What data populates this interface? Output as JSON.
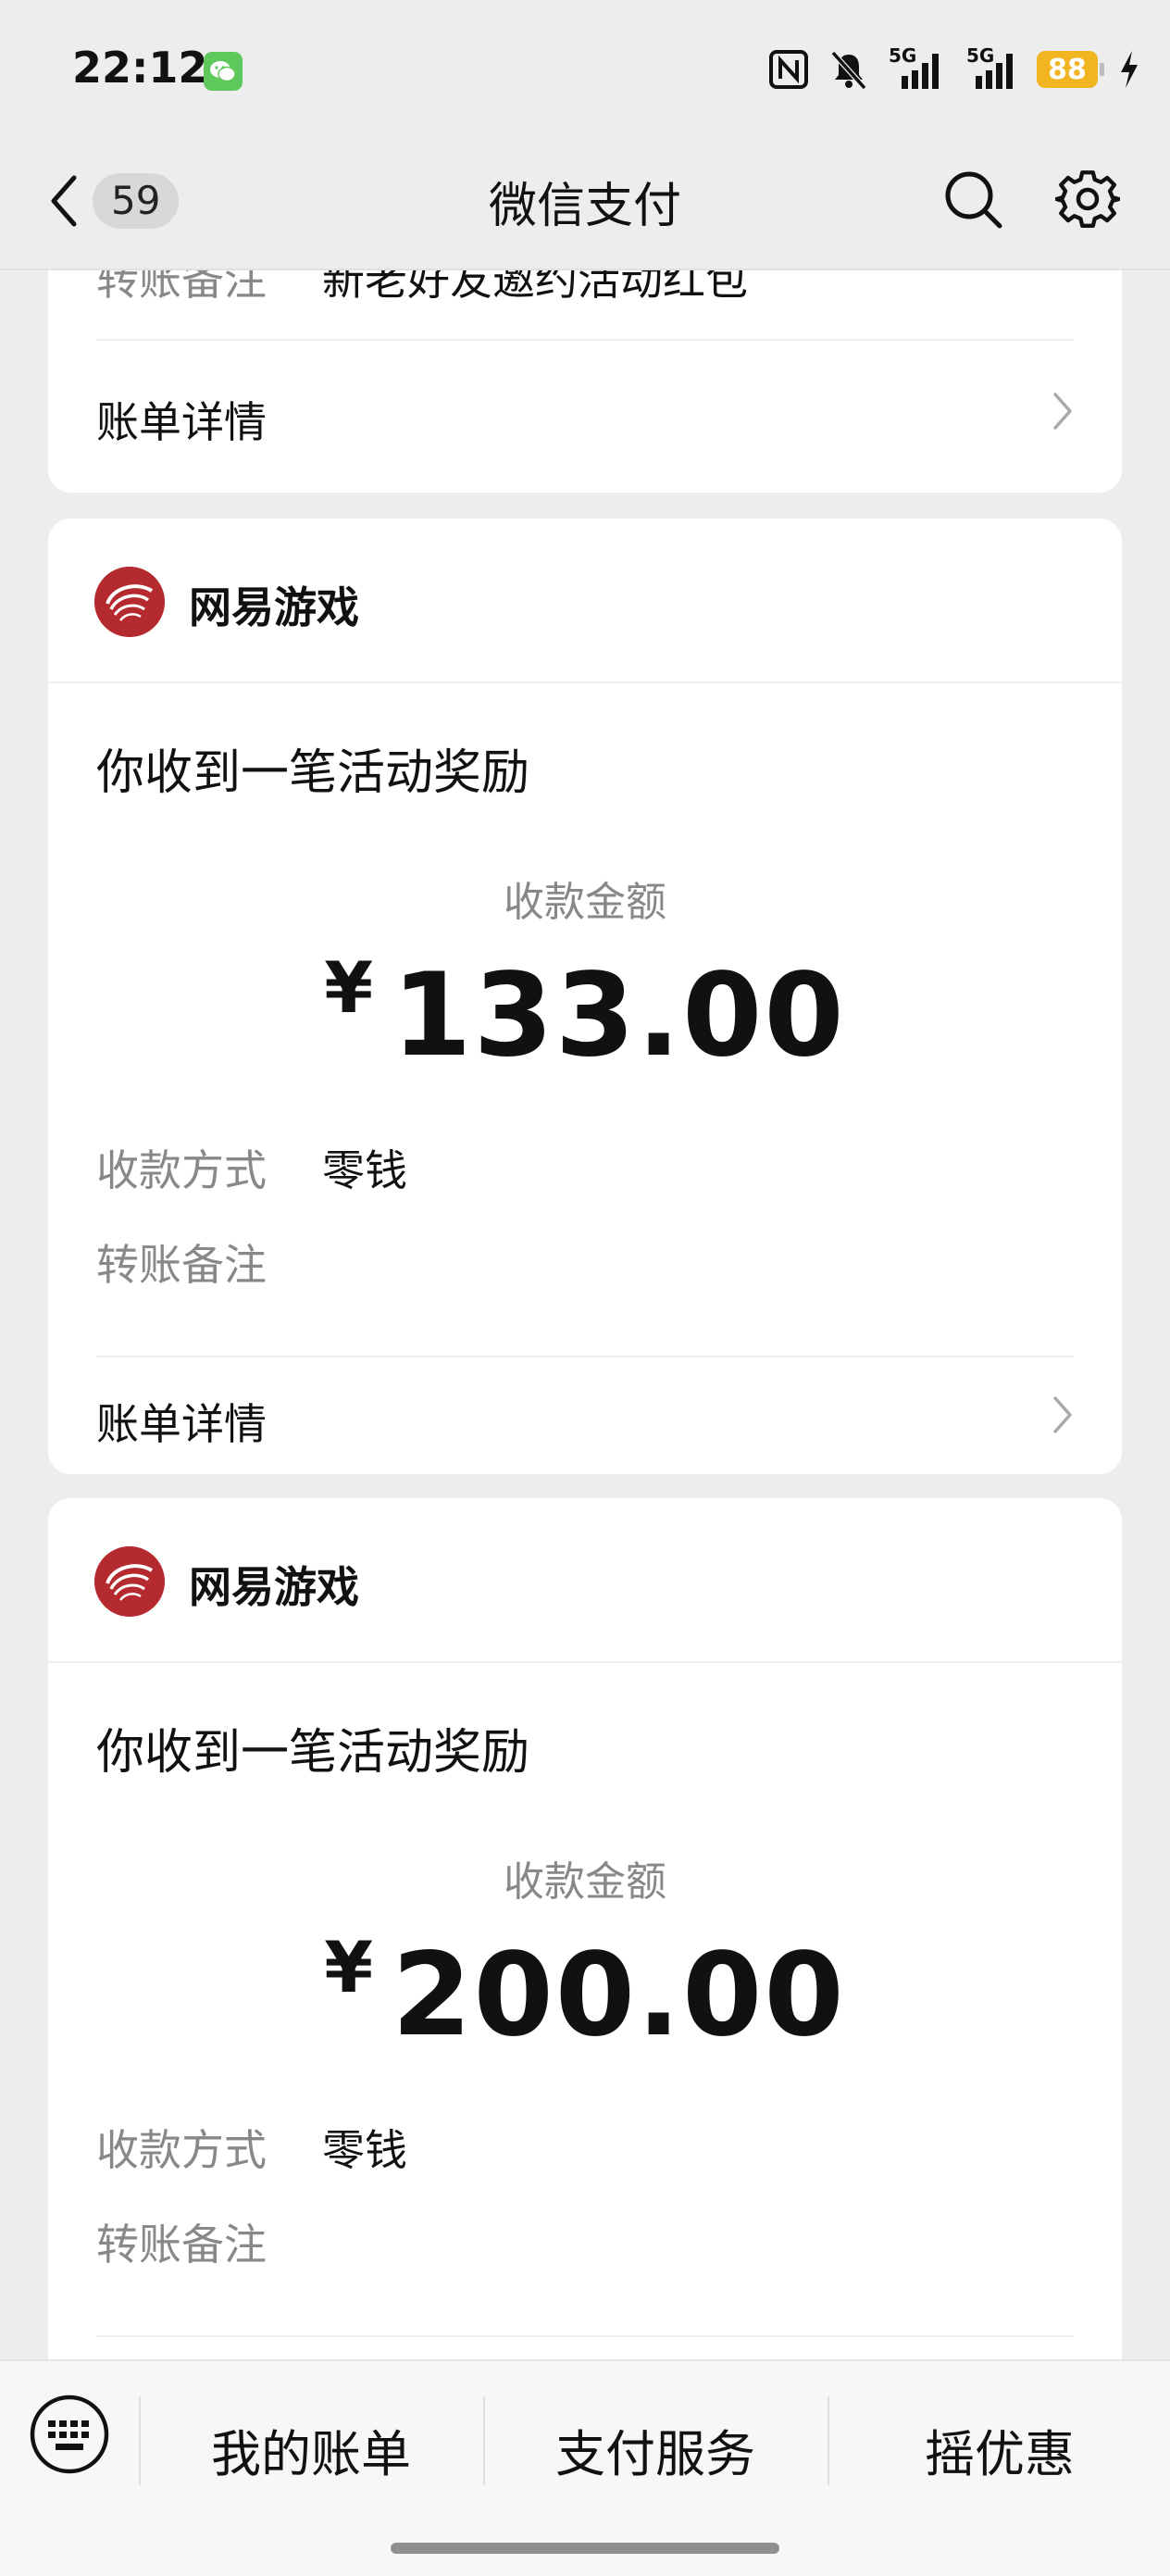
{
  "status_bar": {
    "time": "22:12",
    "battery": "88",
    "network_1": "5G",
    "network_2": "5G"
  },
  "nav": {
    "back_badge": "59",
    "title": "微信支付"
  },
  "first_card": {
    "remark_label": "转账备注",
    "remark_value": "新老好友邀约活动红包",
    "detail_label": "账单详情"
  },
  "cards": [
    {
      "brand": "网易游戏",
      "title": "你收到一笔活动奖励",
      "amount_label": "收款金额",
      "currency": "¥",
      "amount": "133.00",
      "method_label": "收款方式",
      "method_value": "零钱",
      "remark_label": "转账备注",
      "detail_label": "账单详情"
    },
    {
      "brand": "网易游戏",
      "title": "你收到一笔活动奖励",
      "amount_label": "收款金额",
      "currency": "¥",
      "amount": "200.00",
      "method_label": "收款方式",
      "method_value": "零钱",
      "remark_label": "转账备注"
    }
  ],
  "bottom_bar": {
    "tabs": [
      "我的账单",
      "支付服务",
      "摇优惠"
    ]
  },
  "colors": {
    "background": "#ededed",
    "card": "#ffffff",
    "muted_text": "#888888",
    "brand_red": "#b52a2e",
    "battery": "#f2b522",
    "wechat_green": "#5fc85d"
  },
  "icons": [
    "wechat-icon",
    "nfc-icon",
    "bell-muted-icon",
    "signal-icon",
    "charging-icon",
    "back-chevron-icon",
    "search-icon",
    "gear-icon",
    "chevron-right-icon",
    "netease-logo-icon",
    "keyboard-icon"
  ]
}
